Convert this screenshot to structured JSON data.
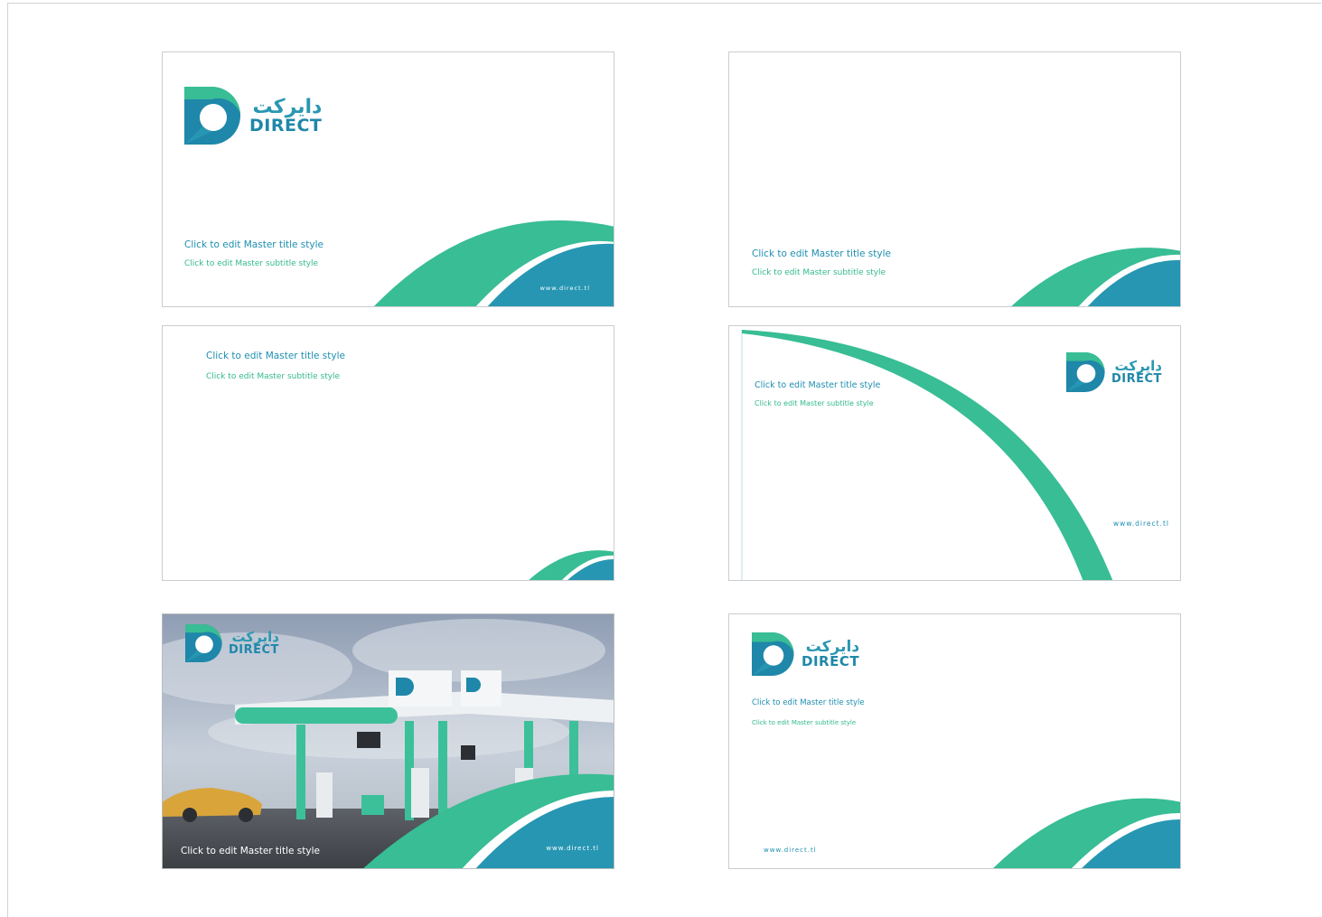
{
  "brand": {
    "name_ar": "دايركت",
    "name_en": "DIRECT",
    "url": "www.direct.tl",
    "colors": {
      "green": "#38bd94",
      "blue": "#2796b2",
      "text_blue": "#1e8fb0",
      "text_green": "#33b98e"
    }
  },
  "slides": [
    {
      "title": "Click to edit Master title style",
      "subtitle": "Click to edit Master subtitle style",
      "url": "www.direct.tl",
      "has_logo": true
    },
    {
      "title": "Click to edit Master title style",
      "subtitle": "Click to edit Master subtitle style",
      "has_logo": false
    },
    {
      "title": "Click to edit Master title style",
      "subtitle": "Click to edit Master subtitle style",
      "has_logo": false
    },
    {
      "title": "Click to edit Master title style",
      "subtitle": "Click to edit Master subtitle style",
      "url": "www.direct.tl",
      "has_logo": true
    },
    {
      "title": "Click to edit Master title style",
      "url": "www.direct.tl",
      "has_logo": true,
      "background": "gas-station-photo"
    },
    {
      "title": "Click to edit Master title style",
      "subtitle": "Click to edit Master subtitle style",
      "url": "www.direct.tl",
      "has_logo": true
    }
  ]
}
